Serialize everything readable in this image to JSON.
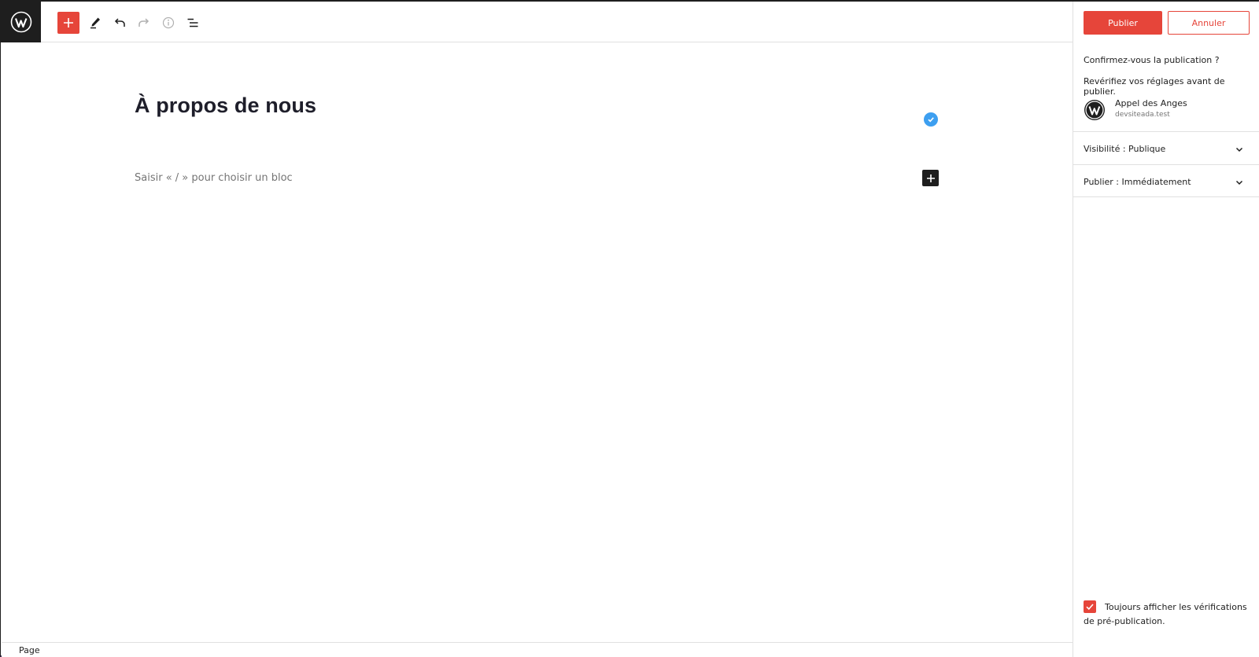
{
  "toolbar": {
    "add_block": "add",
    "tools": "edit",
    "undo": "undo",
    "redo": "redo",
    "details": "info",
    "list_view": "list"
  },
  "editor": {
    "title": "À propos de nous",
    "placeholder": "Saisir « / » pour choisir un bloc"
  },
  "footer": {
    "breadcrumb": "Page"
  },
  "panel": {
    "publish_label": "Publier",
    "cancel_label": "Annuler",
    "confirm_question": "Confirmez-vous la publication ?",
    "confirm_sub": "Revérifiez vos réglages avant de publier.",
    "site_name": "Appel des Anges",
    "site_url": "devsiteada.test",
    "visibility_label": "Visibilité : Publique",
    "publish_time_label": "Publier : Immédiatement",
    "always_show_label": "Toujours afficher les vérifications de pré-publication.",
    "always_show_checked": true
  },
  "colors": {
    "accent": "#e6453a",
    "dark": "#1e1e1e",
    "badge_blue": "#3d9ff0"
  },
  "icons": [
    "wordpress-logo-icon",
    "plus-icon",
    "pencil-icon",
    "undo-icon",
    "redo-icon",
    "info-icon",
    "list-view-icon",
    "check-badge-icon",
    "chevron-down-icon",
    "checkmark-icon"
  ]
}
